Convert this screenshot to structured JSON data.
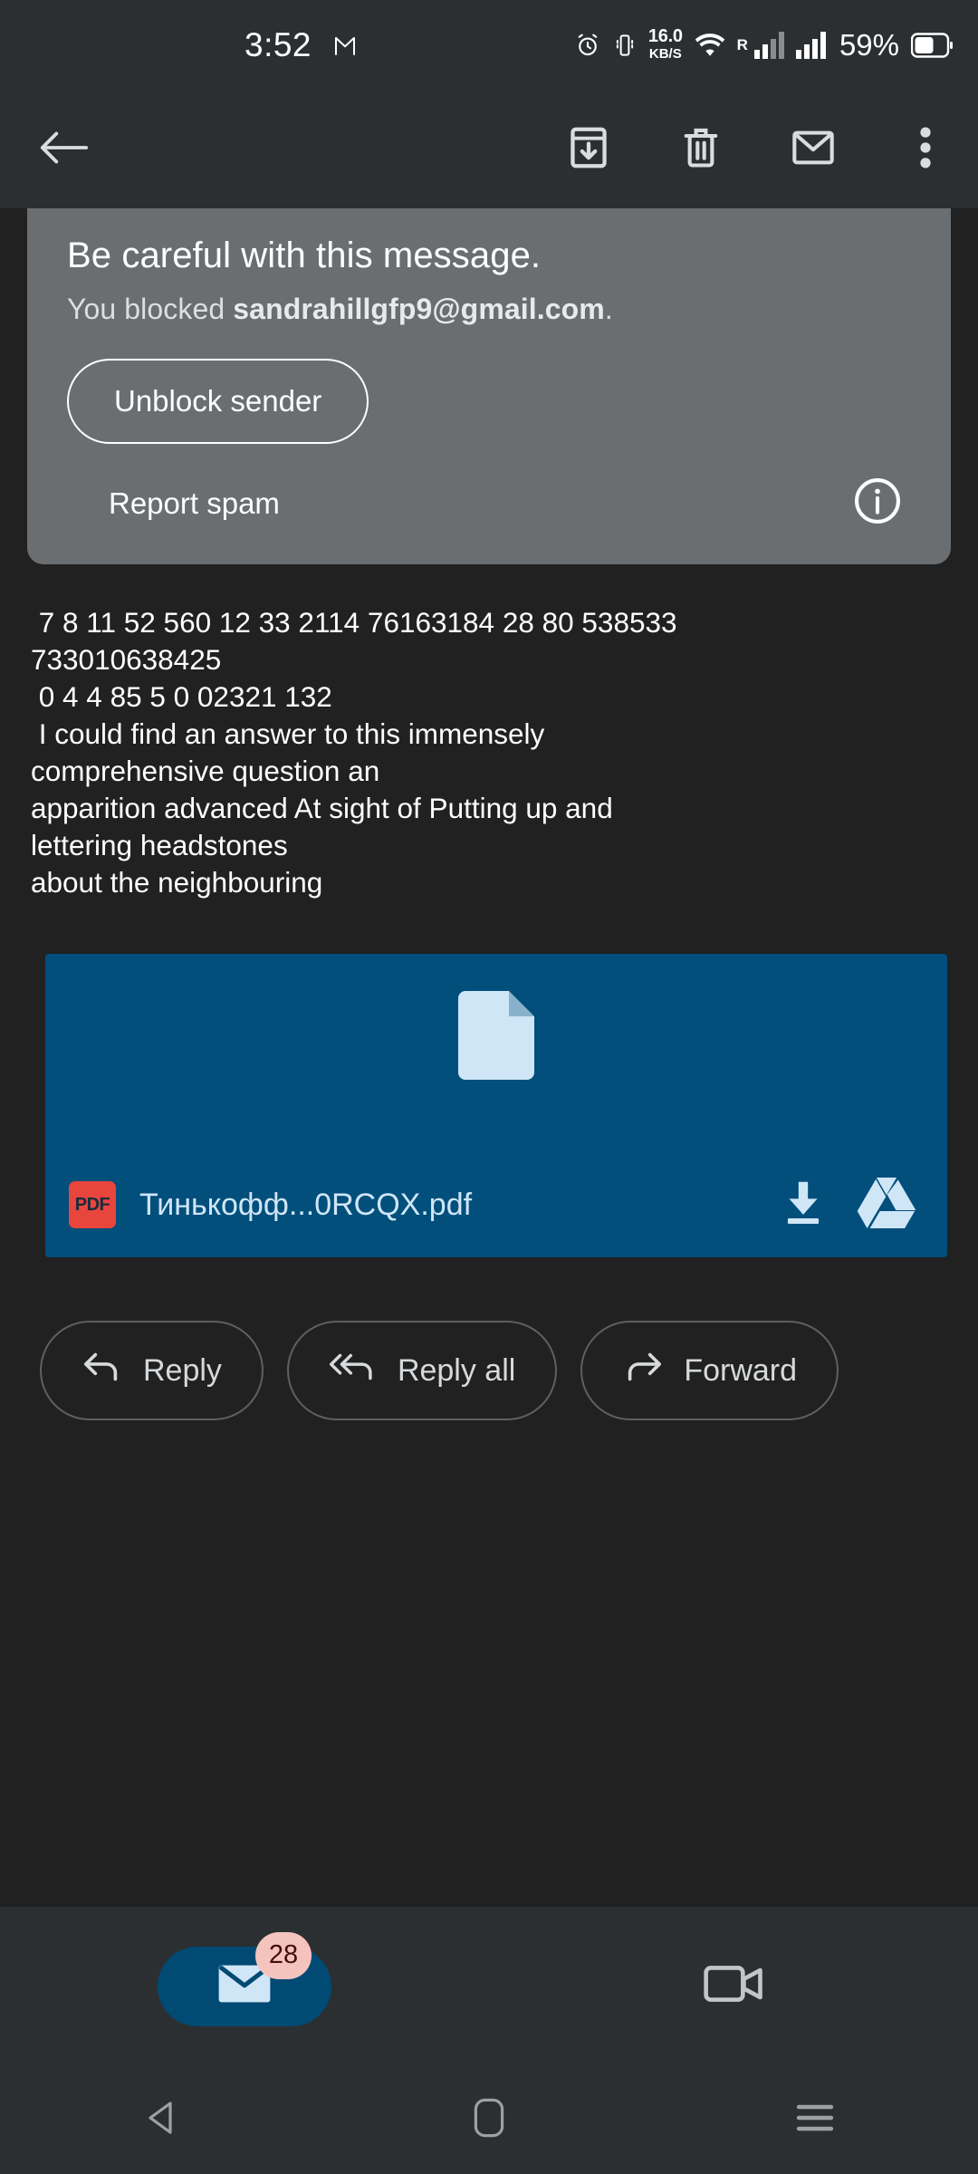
{
  "status_bar": {
    "time": "3:52",
    "gmail_icon": "gmail-m-icon",
    "alarm_icon": "alarm-icon",
    "vibrate_icon": "vibrate-icon",
    "net_speed": "16.0",
    "net_speed_unit": "KB/S",
    "wifi_icon": "wifi-icon",
    "roaming_label": "R",
    "signal_icon": "signal-bars-icon",
    "battery_percent": "59%",
    "battery_icon": "battery-icon"
  },
  "toolbar": {
    "back_label": "back-arrow",
    "archive_label": "Archive",
    "delete_label": "Delete",
    "unread_label": "Mark unread",
    "more_label": "More options"
  },
  "warning": {
    "title": "Be careful with this message.",
    "subtitle_prefix": "You blocked ",
    "blocked_email": "sandrahillgfp9@gmail.com",
    "subtitle_suffix": ".",
    "unblock_label": "Unblock sender",
    "report_spam_label": "Report spam",
    "info_icon": "info-icon",
    "banner_color": "#6b6e71"
  },
  "message": {
    "lines": [
      " 7 8 11 52 560 12 33 2114 76163184 28 80 538533",
      "733010638425",
      " 0 4 4 85 5 0 02321 132",
      " I could find an answer to this immensely",
      "comprehensive question an",
      "apparition advanced At sight of Putting up and",
      "lettering headstones",
      "about the neighbouring"
    ]
  },
  "attachment": {
    "file_type_label": "PDF",
    "file_name": "Тинькофф...0RCQX.pdf",
    "download_icon": "download-icon",
    "drive_icon": "google-drive-icon",
    "card_color": "#024f7c",
    "pdf_chip_color": "#e8453c"
  },
  "actions": {
    "reply_label": "Reply",
    "reply_all_label": "Reply all",
    "forward_label": "Forward"
  },
  "bottom_nav": {
    "mail_label": "Mail",
    "mail_badge": "28",
    "meet_label": "Meet",
    "active_pill_color": "#014a74",
    "badge_color": "#f5c3bd"
  },
  "system_nav": {
    "back_label": "back-triangle",
    "home_label": "home-square",
    "recents_label": "recents-lines"
  }
}
